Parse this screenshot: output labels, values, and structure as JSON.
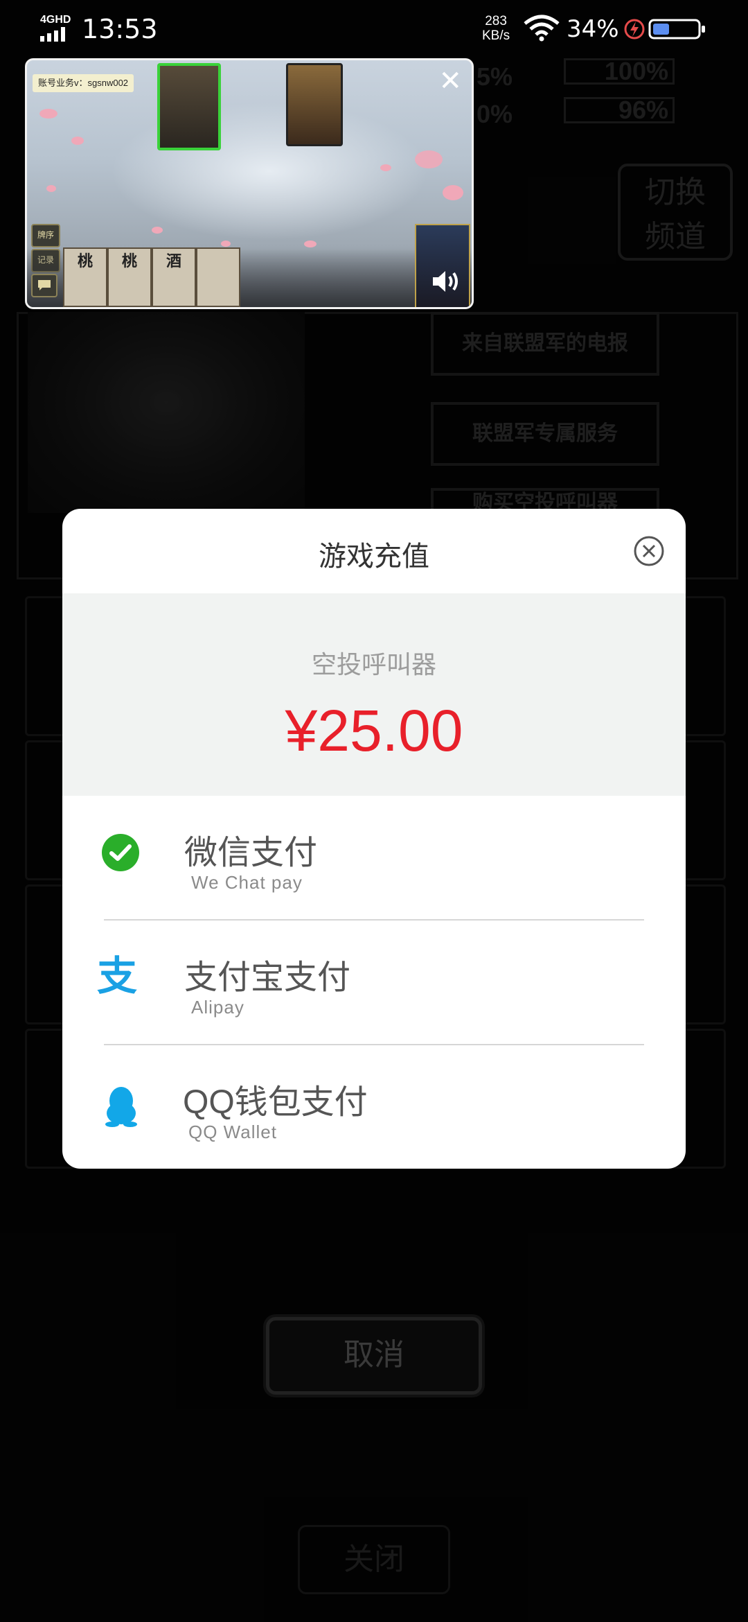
{
  "status_bar": {
    "network": "4GHD",
    "time": "13:53",
    "speed_value": "283",
    "speed_unit": "KB/s",
    "battery": "34%"
  },
  "video": {
    "account_tag": "账号业务v：sgsnw002",
    "hand_cards": [
      "桃",
      "桃",
      "酒"
    ],
    "side_buttons": [
      "牌序",
      "记录"
    ]
  },
  "background": {
    "channel_button": "切换\n频道",
    "menu_items": [
      "来自联盟军的电报",
      "联盟军专属服务",
      "购买空投呼叫器"
    ],
    "bars": [
      "100%",
      "96%"
    ],
    "bars_left": [
      "5%",
      "0%"
    ],
    "cancel_label": "取消",
    "close_label": "关闭"
  },
  "dialog": {
    "title": "游戏充值",
    "product_name": "空投呼叫器",
    "price": "¥25.00",
    "payment_methods": [
      {
        "title": "微信支付",
        "subtitle": "We  Chat  pay",
        "icon": "wechat-pay-icon",
        "color": "#2aae2a"
      },
      {
        "title": "支付宝支付",
        "subtitle": "Alipay",
        "icon": "alipay-icon",
        "color": "#1aa1e4"
      },
      {
        "title": "QQ钱包支付",
        "subtitle": "QQ  Wallet",
        "icon": "qq-wallet-icon",
        "color": "#12a7e8"
      }
    ]
  },
  "colors": {
    "price": "#e8202a",
    "amount_bg": "#f1f3f2",
    "dialog_bg": "#ffffff"
  }
}
